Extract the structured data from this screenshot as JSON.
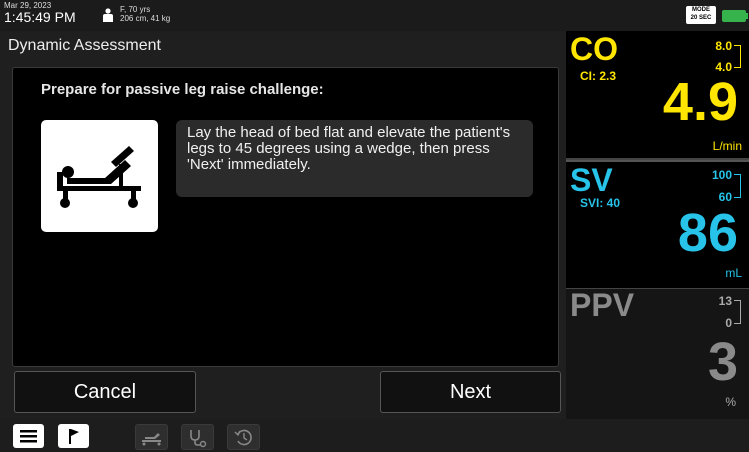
{
  "status": {
    "date": "Mar 29, 2023",
    "time": "1:45:49 PM",
    "patient_line1": "F, 70 yrs",
    "patient_line2": "206 cm, 41 kg",
    "mode_line1": "MODE",
    "mode_line2": "20 SEC"
  },
  "panel": {
    "title": "Dynamic Assessment",
    "prompt": "Prepare for passive leg raise challenge:",
    "message": "Lay the head of bed flat and elevate the patient's legs to 45 degrees using a wedge, then press 'Next' immediately.",
    "icon": "bed-icon",
    "cancel_label": "Cancel",
    "next_label": "Next"
  },
  "params": {
    "co": {
      "name": "CO",
      "sub": "CI: 2.3",
      "value": "4.9",
      "unit": "L/min",
      "upper": "8.0",
      "lower": "4.0",
      "color": "#ffe600"
    },
    "sv": {
      "name": "SV",
      "sub": "SVI: 40",
      "value": "86",
      "unit": "mL",
      "upper": "100",
      "lower": "60",
      "color": "#27c3e8"
    },
    "ppv": {
      "name": "PPV",
      "value": "3",
      "unit": "%",
      "upper": "13",
      "lower": "0",
      "color": "#8a8a8a"
    }
  },
  "bottom_bar": {
    "icons": [
      "menu-icon",
      "flag-icon",
      "bed-icon",
      "stethoscope-icon",
      "history-icon"
    ]
  }
}
